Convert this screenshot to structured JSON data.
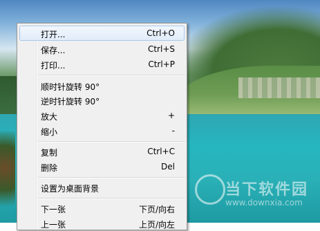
{
  "context_menu": {
    "items": [
      {
        "label": "打开...",
        "shortcut": "Ctrl+O"
      },
      {
        "label": "保存...",
        "shortcut": "Ctrl+S"
      },
      {
        "label": "打印...",
        "shortcut": "Ctrl+P"
      },
      {
        "label": "顺时针旋转 90°",
        "shortcut": ""
      },
      {
        "label": "逆时针旋转 90°",
        "shortcut": ""
      },
      {
        "label": "放大",
        "shortcut": "+"
      },
      {
        "label": "缩小",
        "shortcut": "-"
      },
      {
        "label": "复制",
        "shortcut": "Ctrl+C"
      },
      {
        "label": "删除",
        "shortcut": "Del"
      },
      {
        "label": "设置为桌面背景",
        "shortcut": ""
      },
      {
        "label": "下一张",
        "shortcut": "下页/向右"
      },
      {
        "label": "上一张",
        "shortcut": "上页/向左"
      }
    ],
    "hovered_item": "打开..."
  },
  "watermark": {
    "title": "当下软件园",
    "url": "www.downxia.com"
  },
  "colors": {
    "menu_bg": "#f0f0f0",
    "hover_border": "#a8c8ea"
  }
}
